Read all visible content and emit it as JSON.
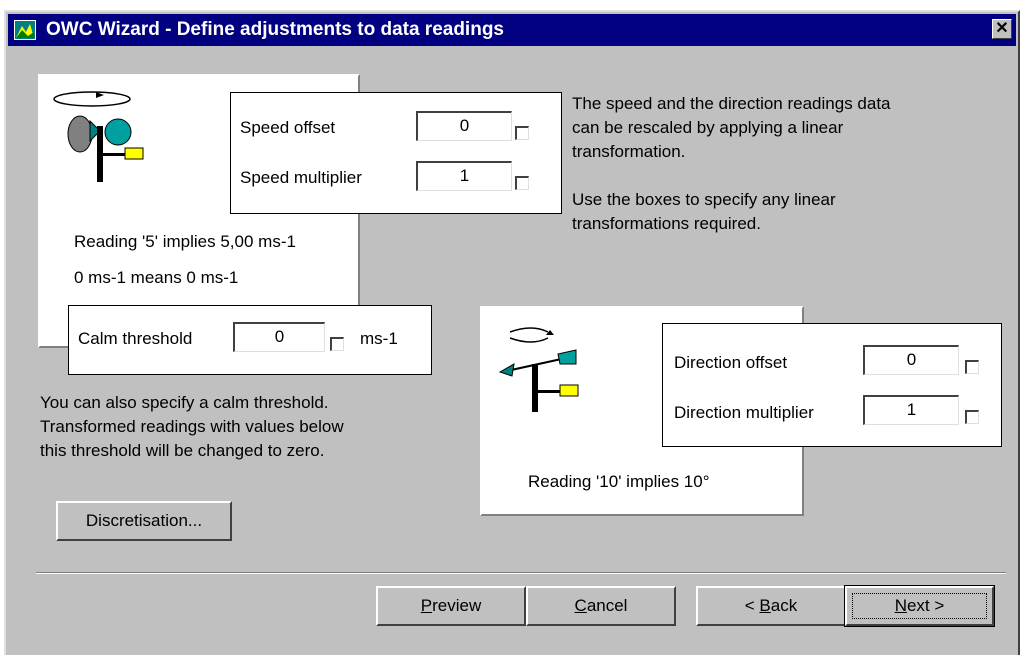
{
  "window": {
    "title": "OWC Wizard - Define adjustments to data readings",
    "close_glyph": "✕"
  },
  "speed": {
    "offset_label": "Speed offset",
    "offset_value": "0",
    "multiplier_label": "Speed multiplier",
    "multiplier_value": "1",
    "reading_text": "Reading '5' implies 5,00 ms-1",
    "means_text": "0 ms-1 means 0 ms-1"
  },
  "calm": {
    "label": "Calm threshold",
    "value": "0",
    "unit": "ms-1"
  },
  "description": {
    "line1": "The speed and the direction readings data",
    "line2": "can be rescaled by applying a linear",
    "line3": "transformation.",
    "line4": "Use the boxes to specify any linear",
    "line5": "transformations required."
  },
  "calm_help": {
    "line1": "You can also specify a calm threshold.",
    "line2": "Transformed readings with values below",
    "line3": "this threshold will be changed to zero."
  },
  "direction": {
    "offset_label": "Direction offset",
    "offset_value": "0",
    "multiplier_label": "Direction multiplier",
    "multiplier_value": "1",
    "reading_text": "Reading '10' implies 10°"
  },
  "buttons": {
    "discretisation": "Discretisation...",
    "preview_key": "P",
    "preview_rest": "review",
    "cancel_key": "C",
    "cancel_rest": "ancel",
    "back_prefix": "< ",
    "back_key": "B",
    "back_rest": "ack",
    "next_key": "N",
    "next_rest": "ext >"
  },
  "icons": {
    "app": "wizard-app-icon",
    "anemometer": "anemometer-icon",
    "wind_vane": "wind-vane-icon"
  }
}
